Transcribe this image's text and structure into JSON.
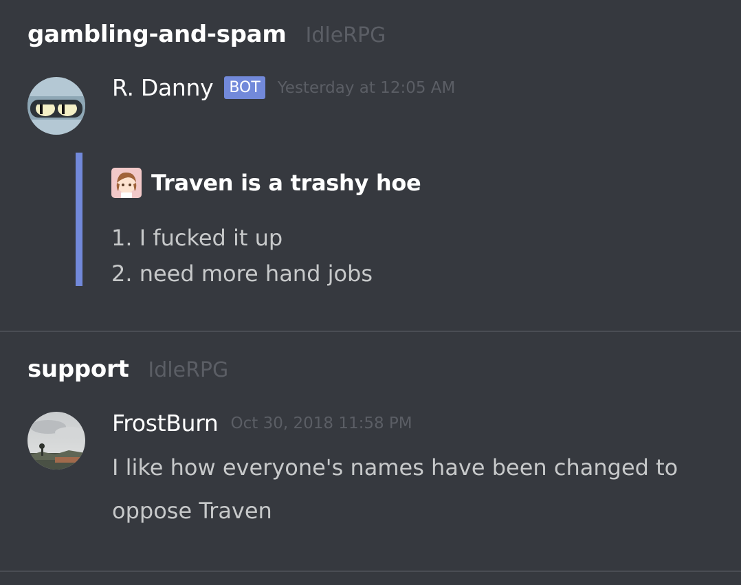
{
  "sections": [
    {
      "channel": "gambling-and-spam",
      "guild": "IdleRPG",
      "message": {
        "author": "R. Danny",
        "bot_tag": "BOT",
        "timestamp": "Yesterday at 12:05 AM",
        "embed": {
          "author_name": "Traven is a trashy hoe",
          "lines": [
            "1. I fucked it up",
            "2. need more hand jobs"
          ],
          "bar_color": "#7289da"
        }
      }
    },
    {
      "channel": "support",
      "guild": "IdleRPG",
      "message": {
        "author": "FrostBurn",
        "timestamp": "Oct 30, 2018 11:58 PM",
        "content_lines": [
          "I like how everyone's names have been changed to",
          "oppose Traven"
        ]
      }
    }
  ],
  "icons": {
    "bot_avatar": "robot-eyes-avatar",
    "embed_author_icon": "anime-character-icon",
    "user_avatar": "cloudy-landscape-avatar"
  },
  "colors": {
    "background": "#36393f",
    "bot_tag": "#7289da",
    "muted_text": "#5b5e65"
  }
}
